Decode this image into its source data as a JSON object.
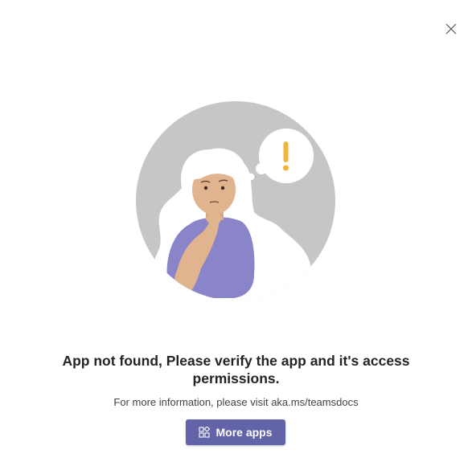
{
  "dialog": {
    "close_icon": "close-icon",
    "illustration": "person-thinking-with-exclamation-bubble",
    "title": "App not found, Please verify the app and it's access permissions.",
    "info": "For more information, please visit aka.ms/teamsdocs",
    "button": {
      "label": "More apps",
      "icon": "apps-grid-icon"
    }
  },
  "colors": {
    "accent": "#6264a7",
    "illustration_bg": "#c8c6c4",
    "exclamation": "#f2b43a",
    "shirt": "#8a84c8",
    "skin": "#e0b48f"
  }
}
